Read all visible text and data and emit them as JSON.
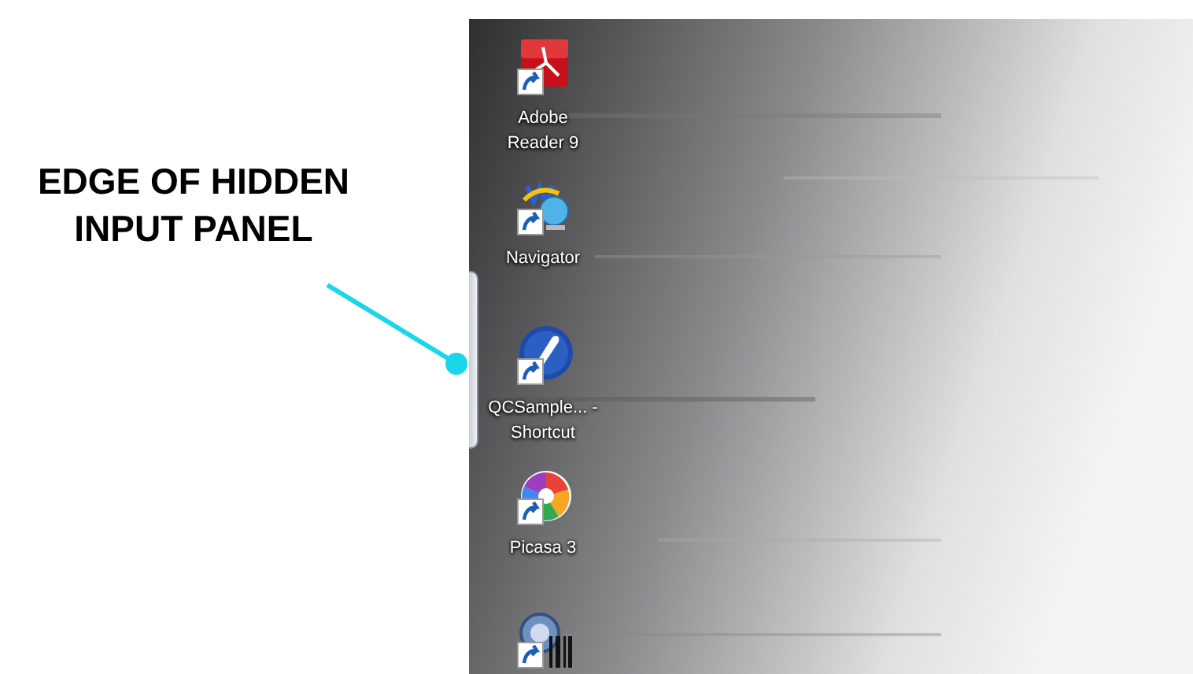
{
  "annotation": {
    "label": "EDGE OF HIDDEN INPUT PANEL"
  },
  "desktop": {
    "input_panel_edge": {
      "kind": "tab"
    },
    "icons": [
      {
        "label": "Adobe Reader 9",
        "kind": "reader"
      },
      {
        "label": "Navigator",
        "kind": "navigator"
      },
      {
        "label": "QCSample... - Shortcut",
        "kind": "qc"
      },
      {
        "label": "Picasa 3",
        "kind": "picasa"
      },
      {
        "kind": "scanner"
      }
    ]
  }
}
